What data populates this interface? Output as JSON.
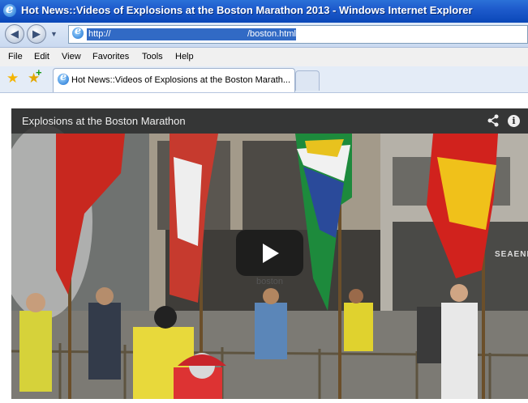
{
  "window": {
    "title": "Hot News::Videos of Explosions at the Boston Marathon 2013 - Windows Internet Explorer"
  },
  "address_bar": {
    "url_start": "http://",
    "url_end": "/boston.html"
  },
  "menu": {
    "items": [
      "File",
      "Edit",
      "View",
      "Favorites",
      "Tools",
      "Help"
    ]
  },
  "tabs": {
    "active_label": "Hot News::Videos of Explosions at the Boston Marath..."
  },
  "video": {
    "title": "Explosions at the Boston Marathon",
    "scene_text": {
      "storefront": "boston",
      "shop_sign": "SEAENE"
    }
  },
  "icons": {
    "browser": "ie-logo-icon",
    "back": "back-arrow-icon",
    "forward": "forward-arrow-icon",
    "favorites": "star-icon",
    "add_favorites": "add-favorite-icon",
    "share": "share-icon",
    "info": "info-icon",
    "play": "play-icon"
  }
}
